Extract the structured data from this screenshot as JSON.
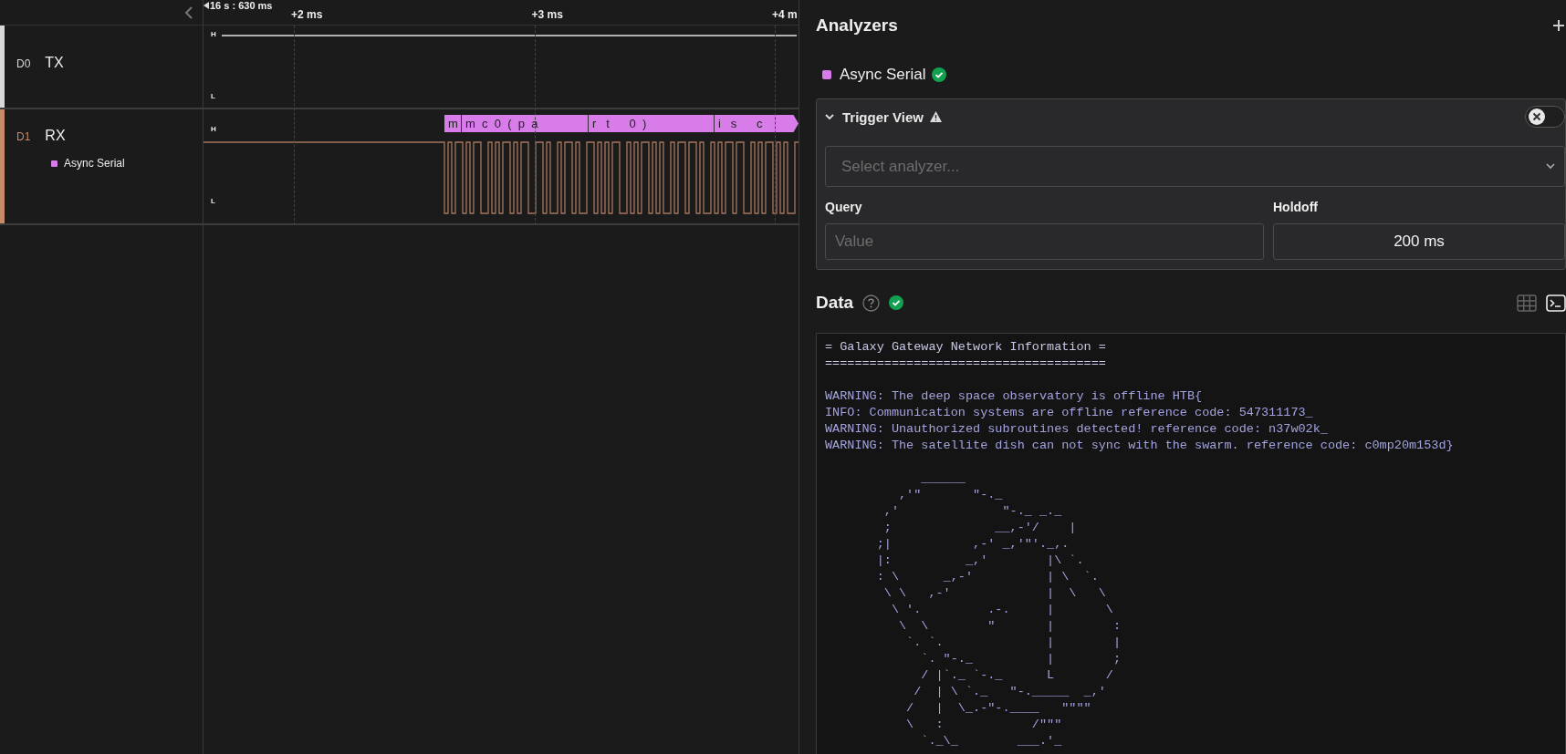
{
  "timeline": {
    "timestamp": "16 s : 630 ms",
    "ticks": [
      "+2 ms",
      "+3 ms",
      "+4 m"
    ]
  },
  "channels": [
    {
      "id": "D0",
      "name": "TX",
      "color": "#d9d9d9",
      "levels": [
        "H",
        "L"
      ]
    },
    {
      "id": "D1",
      "name": "RX",
      "color": "#c98a6b",
      "levels": [
        "H",
        "L"
      ],
      "analyzer": {
        "name": "Async Serial",
        "color": "#d77ce9"
      },
      "frames": [
        "m",
        "m  c  0  (  p  a",
        "r   t      0  )",
        "i   s      c"
      ]
    }
  ],
  "analyzers": {
    "title": "Analyzers",
    "items": [
      {
        "name": "Async Serial",
        "color": "#d77ce9"
      }
    ]
  },
  "trigger": {
    "title": "Trigger View",
    "expanded": true,
    "on": false,
    "select_placeholder": "Select analyzer...",
    "query_label": "Query",
    "query_placeholder": "Value",
    "holdoff_label": "Holdoff",
    "holdoff_value": "200 ms"
  },
  "data": {
    "title": "Data",
    "view_modes": [
      {
        "kind": "table",
        "selected": false
      },
      {
        "kind": "terminal",
        "selected": true
      }
    ],
    "terminal": {
      "blocks": [
        [
          "= Galaxy Gateway Network Information =",
          "======================================"
        ],
        [
          "WARNING: The deep space observatory is offline HTB{",
          "INFO: Communication systems are offline reference code: 547311173_",
          "WARNING: Unauthorized subroutines detected! reference code: n37w02k_",
          "WARNING: The satellite dish can not sync with the swarm. reference code: c0mp20m153d}"
        ],
        [
          "             ______",
          "          ,'\"       \"-._",
          "        ,'              \"-._ _._",
          "        ;              __,-'/    |",
          "       ;|           ,-' _,'\"'._,.",
          "       |:          _,'        |\\ `.",
          "       : \\      _,-'          | \\  `.",
          "        \\ \\   ,-'             |  \\   \\",
          "         \\ '.         .-.     |       \\",
          "          \\  \\        \"       |        :",
          "           `. `.              |        |",
          "             `. \"-._          |        ;",
          "             / |`._ `-._      L       /",
          "            /  | \\ `._   \"-._____  _,'",
          "           /   |  \\_.-\"-.____   \"\"\"\"",
          "           \\   :            /\"\"\"",
          "             `._\\_        ___.'_"
        ]
      ]
    }
  }
}
